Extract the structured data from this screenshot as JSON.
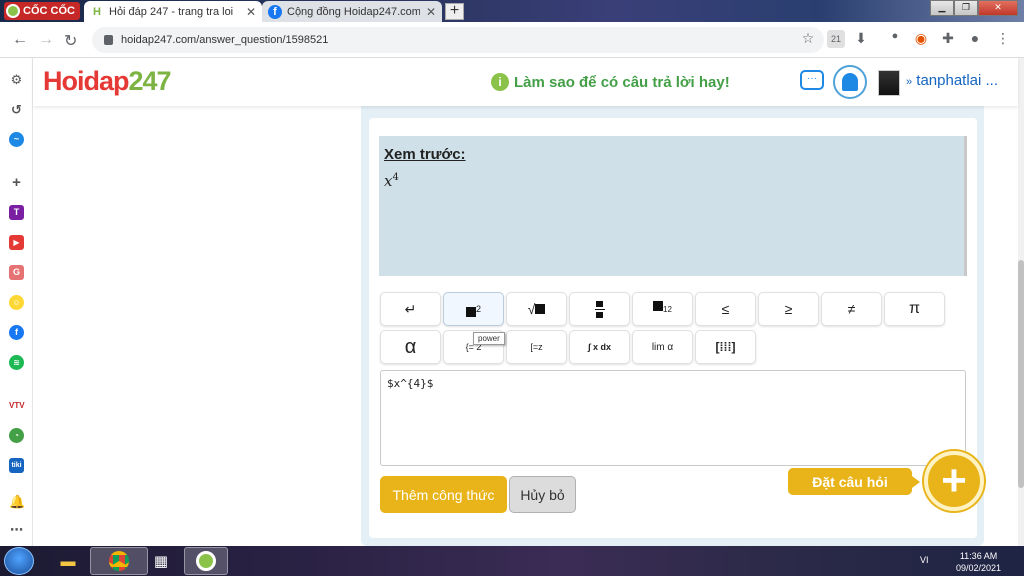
{
  "browser": {
    "brand": "CỐC CỐC",
    "tabs": [
      {
        "title": "Hỏi đáp 247 - trang tra loi",
        "active": true
      },
      {
        "title": "Cộng đồng Hoidap247.com |",
        "active": false
      }
    ],
    "url": "hoidap247.com/answer_question/1598521",
    "extension_badge": "21"
  },
  "site": {
    "logo": {
      "h": "H",
      "rest": "oidap",
      "num": "247"
    },
    "tip": "Làm sao để có câu trả lời hay!",
    "username": "tanphatlai ..."
  },
  "editor": {
    "preview_label": "Xem trước:",
    "preview_math": {
      "base": "x",
      "exponent": "4"
    },
    "tooltip": "power",
    "row1": [
      {
        "name": "newline",
        "glyph": "↵"
      },
      {
        "name": "power",
        "glyph": "2"
      },
      {
        "name": "sqrt",
        "glyph": "√"
      },
      {
        "name": "fraction",
        "glyph": "÷"
      },
      {
        "name": "subscript",
        "glyph": "12"
      },
      {
        "name": "leq",
        "glyph": "≤"
      },
      {
        "name": "geq",
        "glyph": "≥"
      },
      {
        "name": "neq",
        "glyph": "≠"
      },
      {
        "name": "pi",
        "glyph": "π"
      }
    ],
    "row2": [
      {
        "name": "alpha",
        "glyph": "α"
      },
      {
        "name": "system",
        "glyph": "{= 2"
      },
      {
        "name": "cases",
        "glyph": "[=z"
      },
      {
        "name": "integral",
        "glyph": "∫ x dx"
      },
      {
        "name": "limit",
        "glyph": "lim α"
      },
      {
        "name": "matrix",
        "glyph": "[⁞⁞⁞]"
      }
    ],
    "input_value": "$x^{4}$",
    "add_formula": "Thêm công thức",
    "cancel": "Hủy bỏ"
  },
  "ask_question": "Đặt câu hỏi",
  "taskbar": {
    "language": "VI",
    "time": "11:36 AM",
    "date": "09/02/2021"
  }
}
